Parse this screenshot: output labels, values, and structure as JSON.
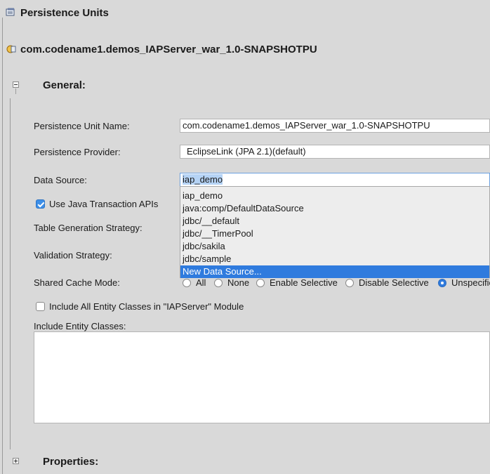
{
  "header": {
    "persistence_units_title": "Persistence Units",
    "unit_title": "com.codename1.demos_IAPServer_war_1.0-SNAPSHOTPU"
  },
  "general": {
    "section_title": "General:",
    "unit_name_label": "Persistence Unit Name:",
    "unit_name_value": "com.codename1.demos_IAPServer_war_1.0-SNAPSHOTPU",
    "provider_label": "Persistence Provider:",
    "provider_value": "EclipseLink (JPA 2.1)(default)",
    "data_source_label": "Data Source:",
    "data_source_value": "iap_demo",
    "use_jta_label": "Use Java Transaction APIs",
    "use_jta_checked": true,
    "table_gen_label": "Table Generation Strategy:",
    "validation_label": "Validation Strategy:",
    "shared_cache_label": "Shared Cache Mode:",
    "shared_cache_options": [
      "All",
      "None",
      "Enable Selective",
      "Disable Selective",
      "Unspecified"
    ],
    "shared_cache_selected": "Unspecified",
    "include_all_label": "Include All Entity Classes in \"IAPServer\" Module",
    "include_all_checked": false,
    "include_entity_label": "Include Entity Classes:"
  },
  "data_source_dropdown": {
    "items": [
      "iap_demo",
      "java:comp/DefaultDataSource",
      "jdbc/__default",
      "jdbc/__TimerPool",
      "jdbc/sakila",
      "jdbc/sample",
      "New Data Source..."
    ],
    "highlighted": "New Data Source..."
  },
  "properties": {
    "section_title": "Properties:"
  },
  "colors": {
    "background": "#d9d9d9",
    "selection": "#2f7bde",
    "checkbox_checked": "#3d8fe8"
  }
}
